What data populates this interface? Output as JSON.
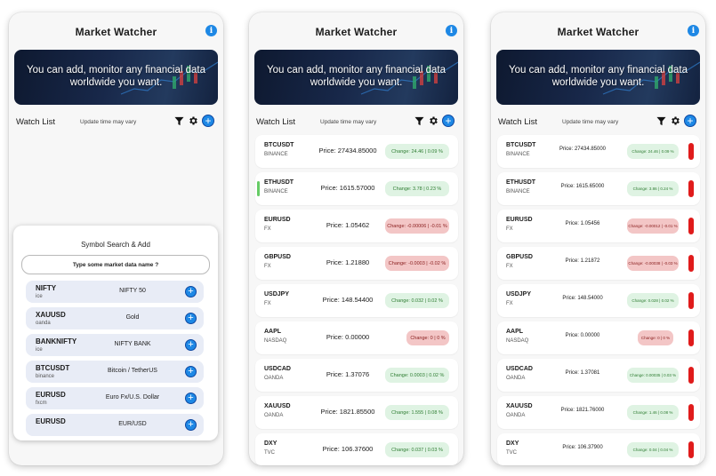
{
  "app": {
    "title": "Market Watcher",
    "banner_text": "You can add, monitor any financial data worldwide you want."
  },
  "watch": {
    "title": "Watch List",
    "subtitle": "Update time may vary"
  },
  "search": {
    "title": "Symbol Search & Add",
    "placeholder": "Type some market data name ?",
    "results": [
      {
        "symbol": "NIFTY",
        "exchange": "ice",
        "name": "NIFTY 50"
      },
      {
        "symbol": "XAUUSD",
        "exchange": "oanda",
        "name": "Gold"
      },
      {
        "symbol": "BANKNIFTY",
        "exchange": "ice",
        "name": "NIFTY BANK"
      },
      {
        "symbol": "BTCUSDT",
        "exchange": "binance",
        "name": "Bitcoin / TetherUS"
      },
      {
        "symbol": "EURUSD",
        "exchange": "fxcm",
        "name": "Euro Fx/U.S. Dollar"
      },
      {
        "symbol": "EURUSD",
        "exchange": "",
        "name": "EUR/USD"
      }
    ]
  },
  "list2": [
    {
      "symbol": "BTCUSDT",
      "exchange": "BINANCE",
      "price": "Price: 27434.85000",
      "change": "Change: 24.46 | 0.09 %",
      "trend": "pos",
      "accent": false
    },
    {
      "symbol": "ETHUSDT",
      "exchange": "BINANCE",
      "price": "Price: 1615.57000",
      "change": "Change: 3.78 | 0.23 %",
      "trend": "pos",
      "accent": true
    },
    {
      "symbol": "EURUSD",
      "exchange": "FX",
      "price": "Price: 1.05462",
      "change": "Change: -0.00006 | -0.01 %",
      "trend": "neg",
      "accent": false
    },
    {
      "symbol": "GBPUSD",
      "exchange": "FX",
      "price": "Price: 1.21880",
      "change": "Change: -0.0003 | -0.02 %",
      "trend": "neg",
      "accent": false
    },
    {
      "symbol": "USDJPY",
      "exchange": "FX",
      "price": "Price: 148.54400",
      "change": "Change: 0.032 | 0.02 %",
      "trend": "pos",
      "accent": false
    },
    {
      "symbol": "AAPL",
      "exchange": "NASDAQ",
      "price": "Price: 0.00000",
      "change": "Change: 0 | 0 %",
      "trend": "neg",
      "accent": false
    },
    {
      "symbol": "USDCAD",
      "exchange": "OANDA",
      "price": "Price: 1.37076",
      "change": "Change: 0.0003 | 0.02 %",
      "trend": "pos",
      "accent": false
    },
    {
      "symbol": "XAUUSD",
      "exchange": "OANDA",
      "price": "Price: 1821.85500",
      "change": "Change: 1.555 | 0.08 %",
      "trend": "pos",
      "accent": false
    },
    {
      "symbol": "DXY",
      "exchange": "TVC",
      "price": "Price: 106.37600",
      "change": "Change: 0.037 | 0.03 %",
      "trend": "pos",
      "accent": false
    }
  ],
  "list3": [
    {
      "symbol": "BTCUSDT",
      "exchange": "BINANCE",
      "price": "Price: 27434.85000",
      "change": "Change: 24.46 | 0.09 %",
      "trend": "pos"
    },
    {
      "symbol": "ETHUSDT",
      "exchange": "BINANCE",
      "price": "Price: 1615.65000",
      "change": "Change: 3.86 | 0.24 %",
      "trend": "pos"
    },
    {
      "symbol": "EURUSD",
      "exchange": "FX",
      "price": "Price: 1.05456",
      "change": "Change: -0.00012 | -0.01 %",
      "trend": "neg"
    },
    {
      "symbol": "GBPUSD",
      "exchange": "FX",
      "price": "Price: 1.21872",
      "change": "Change: -0.00038 | -0.03 %",
      "trend": "neg"
    },
    {
      "symbol": "USDJPY",
      "exchange": "FX",
      "price": "Price: 148.54000",
      "change": "Change: 0.028 | 0.02 %",
      "trend": "pos"
    },
    {
      "symbol": "AAPL",
      "exchange": "NASDAQ",
      "price": "Price: 0.00000",
      "change": "Change: 0 | 0 %",
      "trend": "neg"
    },
    {
      "symbol": "USDCAD",
      "exchange": "OANDA",
      "price": "Price: 1.37081",
      "change": "Change: 0.00035 | 0.03 %",
      "trend": "pos"
    },
    {
      "symbol": "XAUUSD",
      "exchange": "OANDA",
      "price": "Price: 1821.76000",
      "change": "Change: 1.46 | 0.08 %",
      "trend": "pos"
    },
    {
      "symbol": "DXY",
      "exchange": "TVC",
      "price": "Price: 106.37900",
      "change": "Change: 0.04 | 0.04 %",
      "trend": "pos"
    }
  ],
  "icons": {
    "info": "info-icon",
    "filter": "filter-icon",
    "settings": "gear-icon",
    "add": "plus-circle-icon",
    "info_glyph": "i",
    "add_glyph": "+"
  },
  "colors": {
    "accent": "#1e88e5",
    "positive_bg": "#dff3e3",
    "negative_bg": "#f3c6c6",
    "delete": "#e01b1b"
  }
}
